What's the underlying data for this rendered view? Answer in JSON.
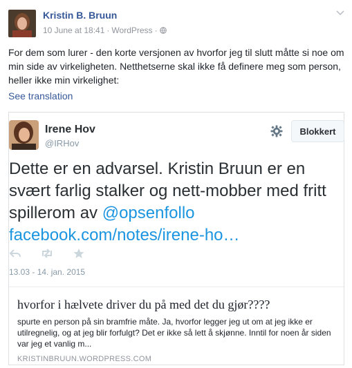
{
  "post": {
    "author": "Kristin B. Bruun",
    "date": "10 June at 18:41",
    "sep": "·",
    "source": "WordPress",
    "sep2": "·",
    "text": "For dem som lurer - den korte versjonen av hvorfor jeg til slutt måtte si noe om min side av virkeligheten. Netthetserne skal ikke få definere meg som person, heller ikke min virkelighet:",
    "see_translation": "See translation"
  },
  "embed": {
    "tweet": {
      "name": "Irene Hov",
      "handle": "@IRHov",
      "block_label": "Blokkert",
      "text_plain": "Dette er en advarsel. Kristin Bruun er en svært farlig stalker og nett-mobber med fritt spillerom av ",
      "mention": "@opsenfollo",
      "link": "facebook.com/notes/irene-ho…",
      "date": "13.03 - 14. jan. 2015"
    },
    "article": {
      "title": "hvorfor i hælvete driver du på med det du gjør????",
      "description": "spurte en person på sin bramfrie måte. Ja, hvorfor legger jeg ut om at jeg ikke er utilregnelig, og at jeg blir forfulgt? Det er ikke så lett å skjønne. Inntil for noen år siden var jeg et vanlig m...",
      "source": "KRISTINBRUUN.WORDPRESS.COM"
    }
  },
  "icons": [
    "globe-icon",
    "chevron-down-icon",
    "gear-icon",
    "reply-icon",
    "retweet-icon",
    "favorite-icon"
  ],
  "colors": {
    "link": "#365899",
    "twitter_link": "#1b95e0",
    "muted": "#90949c"
  }
}
